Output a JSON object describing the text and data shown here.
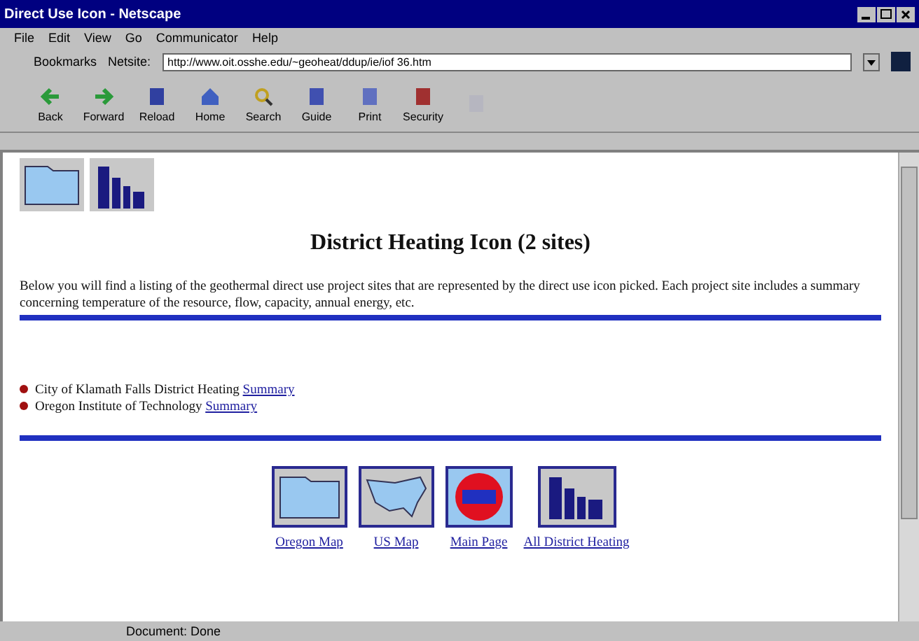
{
  "window": {
    "title": "Direct Use Icon - Netscape"
  },
  "menu": [
    "File",
    "Edit",
    "View",
    "Go",
    "Communicator",
    "Help"
  ],
  "location_bar": {
    "bookmarks": "Bookmarks",
    "label": "Netsite:",
    "url": "http://www.oit.osshe.edu/~geoheat/ddup/ie/iof 36.htm"
  },
  "toolbar": [
    {
      "label": "Back",
      "kind": "back",
      "disabled": false
    },
    {
      "label": "Forward",
      "kind": "forward",
      "disabled": false
    },
    {
      "label": "Reload",
      "kind": "reload",
      "disabled": false
    },
    {
      "label": "Home",
      "kind": "home",
      "disabled": false
    },
    {
      "label": "Search",
      "kind": "search",
      "disabled": false
    },
    {
      "label": "Guide",
      "kind": "guide",
      "disabled": false
    },
    {
      "label": "Print",
      "kind": "print",
      "disabled": false
    },
    {
      "label": "Security",
      "kind": "security",
      "disabled": false
    },
    {
      "kind": "stop",
      "disabled": true
    }
  ],
  "page": {
    "heading": "District Heating Icon (2 sites)",
    "intro": "Below you will find a listing of the geothermal direct use project sites that are represented by the direct use icon picked. Each project site includes a summary concerning temperature of the resource, flow, capacity, annual energy, etc.",
    "sites": [
      {
        "name": "City of Klamath Falls District Heating",
        "link": "Summary"
      },
      {
        "name": "Oregon Institute of Technology",
        "link": "Summary"
      }
    ],
    "nav": [
      {
        "label": "Oregon Map",
        "kind": "oregon"
      },
      {
        "label": "US Map",
        "kind": "us"
      },
      {
        "label": "Main Page",
        "kind": "main"
      },
      {
        "label": "All District Heating",
        "kind": "district"
      }
    ]
  },
  "status_bar": {
    "text": "Document: Done"
  }
}
